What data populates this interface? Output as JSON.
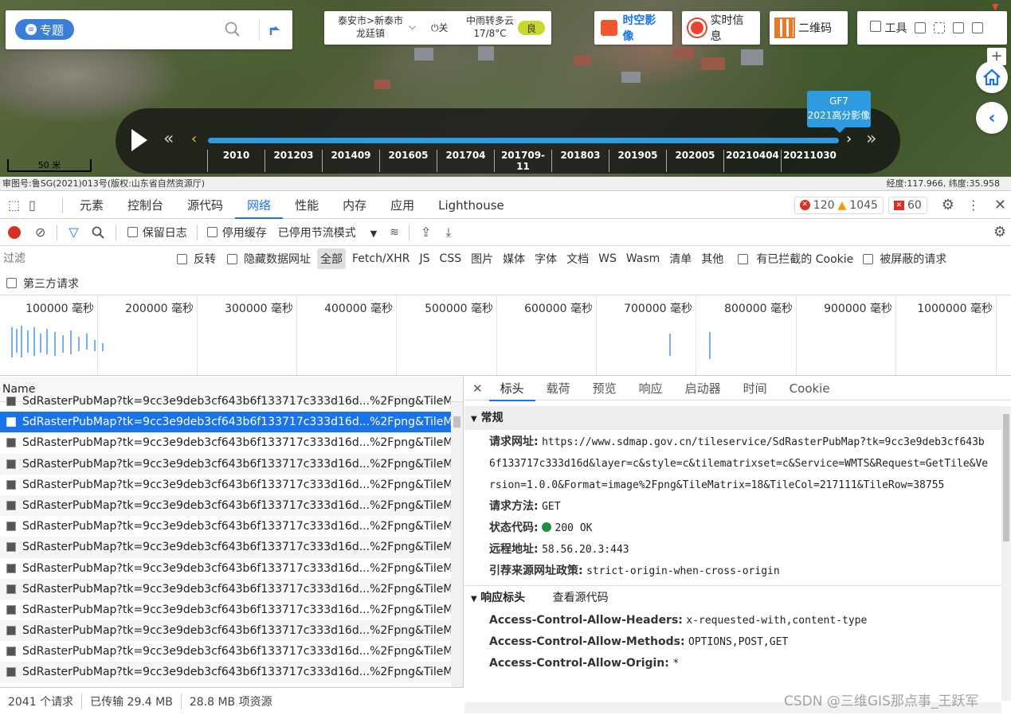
{
  "map": {
    "search": {
      "topic_label": "专题",
      "placeholder": ""
    },
    "location": {
      "line1": "泰安市>新泰市",
      "line2": "龙廷镇",
      "power": "关"
    },
    "weather": {
      "line1": "中雨转多云",
      "line2": "17/8°C",
      "aqi": "良"
    },
    "buttons": {
      "imagery": "时空影像",
      "realtime": "实时信息",
      "qrcode": "二维码",
      "tools": "工具"
    },
    "colors": {
      "accent": "#2e9be0",
      "imagery_text": "#1a73e8",
      "timeline_bg": "#141414"
    },
    "timeline": {
      "years": [
        "2010",
        "201203",
        "201409",
        "201605",
        "201704",
        "201709-11",
        "201803",
        "201905",
        "202005",
        "20210404",
        "20211030"
      ],
      "tip_line1": "GF7",
      "tip_line2": "2021高分影像"
    },
    "scale": "50 米",
    "info_left": "审图号:鲁SG(2021)013号(版权:山东省自然资源厅)",
    "info_right": "经度:117.966, 纬度:35.958"
  },
  "devtools": {
    "tabs": [
      "元素",
      "控制台",
      "源代码",
      "网络",
      "性能",
      "内存",
      "应用",
      "Lighthouse"
    ],
    "active_tab": "网络",
    "errors": "120",
    "warnings": "1045",
    "issues": "60",
    "toolbar": {
      "preserve_log": "保留日志",
      "disable_cache": "停用缓存",
      "throttle": "已停用节流模式"
    },
    "filter": {
      "placeholder": "过滤",
      "invert": "反转",
      "hide_data_urls": "隐藏数据网址",
      "types": [
        "全部",
        "Fetch/XHR",
        "JS",
        "CSS",
        "图片",
        "媒体",
        "字体",
        "文档",
        "WS",
        "Wasm",
        "清单",
        "其他"
      ],
      "blocked_cookies": "有已拦截的 Cookie",
      "blocked_requests": "被屏蔽的请求",
      "third_party": "第三方请求"
    },
    "overview_ticks": [
      "100000 毫秒",
      "200000 毫秒",
      "300000 毫秒",
      "400000 毫秒",
      "500000 毫秒",
      "600000 毫秒",
      "700000 毫秒",
      "800000 毫秒",
      "900000 毫秒",
      "1000000 毫秒"
    ],
    "list": {
      "header": "Name",
      "rows": [
        "SdRasterPubMap?tk=9cc3e9deb3cf643b6f133717c333d16d...%2Fpng&TileMatri...",
        "SdRasterPubMap?tk=9cc3e9deb3cf643b6f133717c333d16d...%2Fpng&TileMatri...",
        "SdRasterPubMap?tk=9cc3e9deb3cf643b6f133717c333d16d...%2Fpng&TileMatri...",
        "SdRasterPubMap?tk=9cc3e9deb3cf643b6f133717c333d16d...%2Fpng&TileMatri...",
        "SdRasterPubMap?tk=9cc3e9deb3cf643b6f133717c333d16d...%2Fpng&TileMatri...",
        "SdRasterPubMap?tk=9cc3e9deb3cf643b6f133717c333d16d...%2Fpng&TileMatri...",
        "SdRasterPubMap?tk=9cc3e9deb3cf643b6f133717c333d16d...%2Fpng&TileMatri...",
        "SdRasterPubMap?tk=9cc3e9deb3cf643b6f133717c333d16d...%2Fpng&TileMatri...",
        "SdRasterPubMap?tk=9cc3e9deb3cf643b6f133717c333d16d...%2Fpng&TileMatri...",
        "SdRasterPubMap?tk=9cc3e9deb3cf643b6f133717c333d16d...%2Fpng&TileMatri...",
        "SdRasterPubMap?tk=9cc3e9deb3cf643b6f133717c333d16d...%2Fpng&TileMatri...",
        "SdRasterPubMap?tk=9cc3e9deb3cf643b6f133717c333d16d...%2Fpng&TileMatri...",
        "SdRasterPubMap?tk=9cc3e9deb3cf643b6f133717c333d16d...%2Fpng&TileMatri...",
        "SdRasterPubMap?tk=9cc3e9deb3cf643b6f133717c333d16d...%2Fpng&TileMatri..."
      ],
      "selected_index": 1
    },
    "status": {
      "requests": "2041 个请求",
      "transferred": "已传输 29.4 MB",
      "resources": "28.8 MB 项资源"
    },
    "detail": {
      "tabs": [
        "标头",
        "载荷",
        "预览",
        "响应",
        "启动器",
        "时间",
        "Cookie"
      ],
      "active_tab": "标头",
      "general_title": "常规",
      "request_url_label": "请求网址:",
      "request_url": "https://www.sdmap.gov.cn/tileservice/SdRasterPubMap?tk=9cc3e9deb3cf643b6f133717c333d16d&layer=c&style=c&tilematrixset=c&Service=WMTS&Request=GetTile&Version=1.0.0&Format=image%2Fpng&TileMatrix=18&TileCol=217111&TileRow=38755",
      "method_label": "请求方法:",
      "method": "GET",
      "status_label": "状态代码:",
      "status": "200 OK",
      "remote_label": "远程地址:",
      "remote": "58.56.20.3:443",
      "referrer_label": "引荐来源网址政策:",
      "referrer": "strict-origin-when-cross-origin",
      "response_title": "响应标头",
      "view_source": "查看源代码",
      "headers": [
        {
          "k": "Access-Control-Allow-Headers:",
          "v": "x-requested-with,content-type"
        },
        {
          "k": "Access-Control-Allow-Methods:",
          "v": "OPTIONS,POST,GET"
        },
        {
          "k": "Access-Control-Allow-Origin:",
          "v": "*"
        }
      ]
    }
  },
  "watermark": "CSDN @三维GIS那点事_王跃军"
}
